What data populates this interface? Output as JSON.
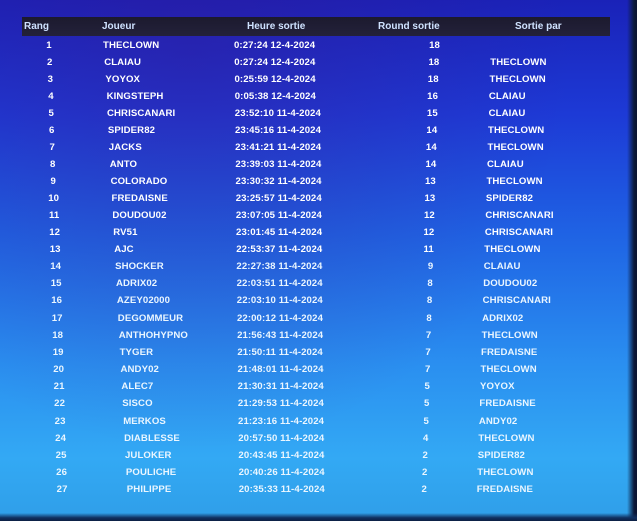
{
  "table": {
    "columns": [
      "Rang",
      "Joueur",
      "Heure sortie",
      "Round sortie",
      "Sortie par"
    ],
    "rows": [
      {
        "rang": "1",
        "joueur": "THECLOWN",
        "heure": "0:27:24 12-4-2024",
        "round": "18",
        "par": ""
      },
      {
        "rang": "2",
        "joueur": "CLAIAU",
        "heure": "0:27:24 12-4-2024",
        "round": "18",
        "par": "THECLOWN"
      },
      {
        "rang": "3",
        "joueur": "YOYOX",
        "heure": "0:25:59 12-4-2024",
        "round": "18",
        "par": "THECLOWN"
      },
      {
        "rang": "4",
        "joueur": "KINGSTEPH",
        "heure": "0:05:38 12-4-2024",
        "round": "16",
        "par": "CLAIAU"
      },
      {
        "rang": "5",
        "joueur": "CHRISCANARI",
        "heure": "23:52:10 11-4-2024",
        "round": "15",
        "par": "CLAIAU"
      },
      {
        "rang": "6",
        "joueur": "SPIDER82",
        "heure": "23:45:16 11-4-2024",
        "round": "14",
        "par": "THECLOWN"
      },
      {
        "rang": "7",
        "joueur": "JACKS",
        "heure": "23:41:21 11-4-2024",
        "round": "14",
        "par": "THECLOWN"
      },
      {
        "rang": "8",
        "joueur": "ANTO",
        "heure": "23:39:03 11-4-2024",
        "round": "14",
        "par": "CLAIAU"
      },
      {
        "rang": "9",
        "joueur": "COLORADO",
        "heure": "23:30:32 11-4-2024",
        "round": "13",
        "par": "THECLOWN"
      },
      {
        "rang": "10",
        "joueur": "FREDAISNE",
        "heure": "23:25:57 11-4-2024",
        "round": "13",
        "par": "SPIDER82"
      },
      {
        "rang": "11",
        "joueur": "DOUDOU02",
        "heure": "23:07:05 11-4-2024",
        "round": "12",
        "par": "CHRISCANARI"
      },
      {
        "rang": "12",
        "joueur": "RV51",
        "heure": "23:01:45 11-4-2024",
        "round": "12",
        "par": "CHRISCANARI"
      },
      {
        "rang": "13",
        "joueur": "AJC",
        "heure": "22:53:37 11-4-2024",
        "round": "11",
        "par": "THECLOWN"
      },
      {
        "rang": "14",
        "joueur": "SHOCKER",
        "heure": "22:27:38 11-4-2024",
        "round": "9",
        "par": "CLAIAU"
      },
      {
        "rang": "15",
        "joueur": "ADRIX02",
        "heure": "22:03:51 11-4-2024",
        "round": "8",
        "par": "DOUDOU02"
      },
      {
        "rang": "16",
        "joueur": "AZEY02000",
        "heure": "22:03:10 11-4-2024",
        "round": "8",
        "par": "CHRISCANARI"
      },
      {
        "rang": "17",
        "joueur": "DEGOMMEUR",
        "heure": "22:00:12 11-4-2024",
        "round": "8",
        "par": "ADRIX02"
      },
      {
        "rang": "18",
        "joueur": "ANTHOHYPNO",
        "heure": "21:56:43 11-4-2024",
        "round": "7",
        "par": "THECLOWN"
      },
      {
        "rang": "19",
        "joueur": "TYGER",
        "heure": "21:50:11 11-4-2024",
        "round": "7",
        "par": "FREDAISNE"
      },
      {
        "rang": "20",
        "joueur": "ANDY02",
        "heure": "21:48:01 11-4-2024",
        "round": "7",
        "par": "THECLOWN"
      },
      {
        "rang": "21",
        "joueur": "ALEC7",
        "heure": "21:30:31 11-4-2024",
        "round": "5",
        "par": "YOYOX"
      },
      {
        "rang": "22",
        "joueur": "SISCO",
        "heure": "21:29:53 11-4-2024",
        "round": "5",
        "par": "FREDAISNE"
      },
      {
        "rang": "23",
        "joueur": "MERKOS",
        "heure": "21:23:16 11-4-2024",
        "round": "5",
        "par": "ANDY02"
      },
      {
        "rang": "24",
        "joueur": "DIABLESSE",
        "heure": "20:57:50 11-4-2024",
        "round": "4",
        "par": "THECLOWN"
      },
      {
        "rang": "25",
        "joueur": "JULOKER",
        "heure": "20:43:45 11-4-2024",
        "round": "2",
        "par": "SPIDER82"
      },
      {
        "rang": "26",
        "joueur": "POULICHE",
        "heure": "20:40:26 11-4-2024",
        "round": "2",
        "par": "THECLOWN"
      },
      {
        "rang": "27",
        "joueur": "PHILIPPE",
        "heure": "20:35:33 11-4-2024",
        "round": "2",
        "par": "FREDAISNE"
      }
    ]
  }
}
